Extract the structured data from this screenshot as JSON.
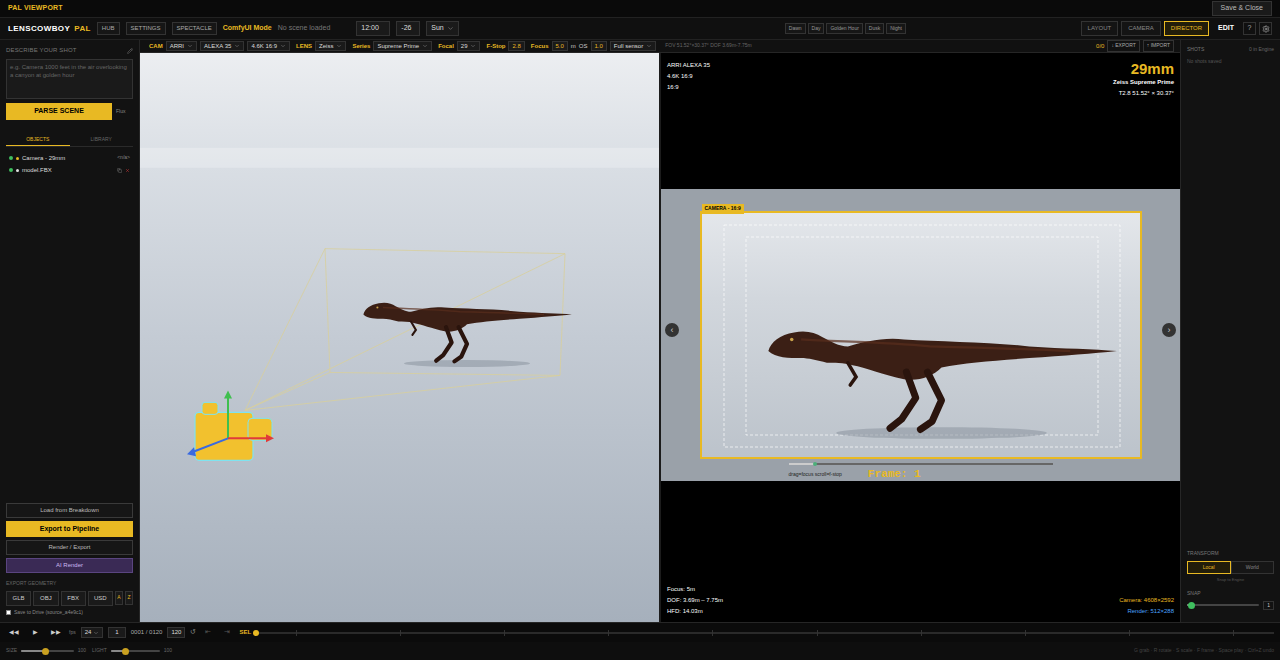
{
  "window": {
    "title": "PAL VIEWPORT",
    "save_button": "Save & Close"
  },
  "toolbar": {
    "logo": "LENSCOWBOY",
    "logo_accent": "PAL",
    "nav": [
      "HUB",
      "SETTINGS",
      "SPECTACLE"
    ],
    "mode": "ComfyUI Mode",
    "scene": "No scene loaded",
    "time": "12:00",
    "offset": "-26",
    "sun": "Sun",
    "presets": [
      "Dawn",
      "Day",
      "Golden Hour",
      "Dusk",
      "Night"
    ],
    "views": [
      {
        "label": "LAYOUT",
        "selected": false
      },
      {
        "label": "CAMERA",
        "selected": false
      },
      {
        "label": "DIRECTOR",
        "selected": true
      }
    ],
    "edit": "EDIT",
    "help": "?"
  },
  "camera_bar": {
    "items": [
      {
        "kind": "label",
        "text": "CAM"
      },
      {
        "kind": "select",
        "text": "ARRI"
      },
      {
        "kind": "select",
        "text": "ALEXA 35"
      },
      {
        "kind": "select",
        "text": "4.6K 16:9"
      },
      {
        "kind": "label",
        "text": "LENS"
      },
      {
        "kind": "select",
        "text": "Zeiss"
      },
      {
        "kind": "label",
        "text": "Series"
      },
      {
        "kind": "select",
        "text": "Supreme Prime"
      },
      {
        "kind": "label",
        "text": "Focal"
      },
      {
        "kind": "select",
        "text": "29"
      },
      {
        "kind": "label",
        "text": "F-Stop"
      },
      {
        "kind": "value",
        "text": "2.8"
      },
      {
        "kind": "label",
        "text": "Focus"
      },
      {
        "kind": "value",
        "text": "5.0"
      },
      {
        "kind": "unit",
        "text": "m"
      },
      {
        "kind": "unit",
        "text": "OS"
      },
      {
        "kind": "value",
        "text": "1.0"
      },
      {
        "kind": "select",
        "text": "Full sensor"
      },
      {
        "kind": "info",
        "text": "FOV 51.52°×30.37° DOF 3.69m-7.75m"
      }
    ],
    "shot_count": "0/0",
    "export": "↓ EXPORT",
    "import": "↑ IMPORT"
  },
  "sidebar": {
    "describe_label": "DESCRIBE YOUR SHOT",
    "placeholder": "e.g. Camera 1000 feet in the air overlooking a canyon at golden hour",
    "parse_button": "PARSE SCENE",
    "model": "Flux",
    "tabs": [
      {
        "label": "OBJECTS",
        "selected": true
      },
      {
        "label": "LIBRARY",
        "selected": false
      }
    ],
    "objects": [
      {
        "name": "Camera - 29mm",
        "kind": "camera",
        "visible": true,
        "color": "#e8b923",
        "tag": "<n/a>"
      },
      {
        "name": "model.FBX",
        "kind": "model",
        "visible": true,
        "color": "#e0e0e0",
        "tag": ""
      }
    ],
    "actions": [
      {
        "label": "Load from Breakdown",
        "kind": "outline"
      },
      {
        "label": "Export to Pipeline",
        "kind": "primary"
      },
      {
        "label": "Render / Export",
        "kind": "outline"
      },
      {
        "label": "AI Render",
        "kind": "ai"
      }
    ],
    "export_label": "EXPORT GEOMETRY",
    "formats": [
      "GLB",
      "OBJ",
      "FBX",
      "USD"
    ],
    "extra": [
      "A",
      "Z"
    ],
    "drive": {
      "label": "Save to Drive (source_a4e9c1)",
      "checked": false
    }
  },
  "preview": {
    "camera": "ARRI ALEXA 35",
    "format": "4.6K 16:9",
    "aspect": "16:9",
    "focal": "29mm",
    "lens": "Zeiss Supreme Prime",
    "optics": "T2.8  51.52° × 30.37°",
    "frame_label": "CAMERA - 16:9",
    "prev": "‹",
    "next": "›",
    "hint": "drag=focus  scroll=f-stop",
    "focus_level": 0.1,
    "frame": "Frame: 1",
    "focus": "Focus: 5m",
    "dof": "DOF: 3.69m – 7.75m",
    "hfd": "HFD: 14.03m",
    "camera_res": "Camera: 4608×2592",
    "render_res": "Render: 512×288"
  },
  "shots": {
    "title": "SHOTS",
    "count": "0 in Engine",
    "empty": "No shots saved"
  },
  "transform": {
    "title": "TRANSFORM",
    "spaces": [
      {
        "label": "Local",
        "selected": true
      },
      {
        "label": "World",
        "selected": false
      }
    ],
    "hint": "Snap to Engine",
    "snap_label": "SNAP",
    "snap_level": 0.05,
    "snap_value": "1"
  },
  "timeline": {
    "buttons": [
      "◀◀",
      "▶",
      "▶▶"
    ],
    "fps_label": "fps",
    "fps": "24",
    "frame": "1",
    "range": "0001 / 0120",
    "end": "120",
    "loop": "↺",
    "steps": [
      "⇤",
      "⇥"
    ],
    "sel": "SEL",
    "level": 0
  },
  "footer": {
    "sliders": [
      {
        "label": "SIZE",
        "level": 0.45,
        "value": "100"
      },
      {
        "label": "LIGHT",
        "level": 0.3,
        "value": "100"
      }
    ],
    "text": "G grab · R rotate · S scale · F frame · Space play · Ctrl+Z undo"
  }
}
